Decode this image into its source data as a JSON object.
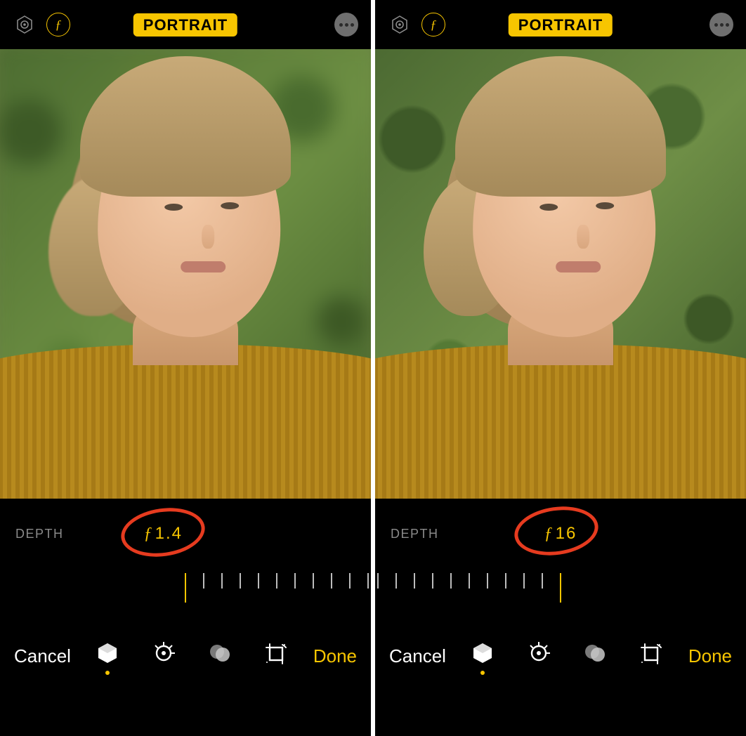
{
  "panels": {
    "left": {
      "mode_label": "PORTRAIT",
      "depth_label": "DEPTH",
      "f_value_display": "1.4",
      "slider": {
        "indicator_position_pct": 50,
        "ticks_total": 11,
        "ticks_left_of_indicator": 0
      },
      "bottom": {
        "cancel": "Cancel",
        "done": "Done"
      }
    },
    "right": {
      "mode_label": "PORTRAIT",
      "depth_label": "DEPTH",
      "f_value_display": "16",
      "slider": {
        "indicator_position_pct": 50,
        "ticks_total": 11,
        "ticks_left_of_indicator": 10
      },
      "bottom": {
        "cancel": "Cancel",
        "done": "Done"
      }
    }
  },
  "icons": {
    "live": "live-photo-icon",
    "aperture": "aperture-f-icon",
    "more": "more-icon",
    "tool_lighting": "portrait-lighting-icon",
    "tool_adjust": "adjust-dial-icon",
    "tool_filters": "filters-icon",
    "tool_crop": "crop-rotate-icon"
  },
  "colors": {
    "accent": "#f7c500",
    "annotation": "#e63b1f"
  }
}
